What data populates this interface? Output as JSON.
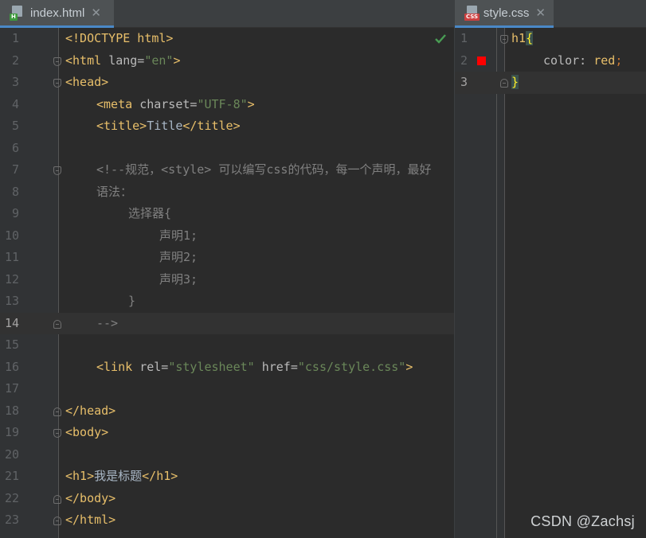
{
  "left_tab": {
    "label": "index.html",
    "badge": "H",
    "close": "✕"
  },
  "right_tab": {
    "label": "style.css",
    "badge": "CSS",
    "close": "✕"
  },
  "left_lines": [
    {
      "n": "1"
    },
    {
      "n": "2"
    },
    {
      "n": "3"
    },
    {
      "n": "4"
    },
    {
      "n": "5"
    },
    {
      "n": "6"
    },
    {
      "n": "7"
    },
    {
      "n": "8"
    },
    {
      "n": "9"
    },
    {
      "n": "10"
    },
    {
      "n": "11"
    },
    {
      "n": "12"
    },
    {
      "n": "13"
    },
    {
      "n": "14"
    },
    {
      "n": "15"
    },
    {
      "n": "16"
    },
    {
      "n": "17"
    },
    {
      "n": "18"
    },
    {
      "n": "19"
    },
    {
      "n": "20"
    },
    {
      "n": "21"
    },
    {
      "n": "22"
    },
    {
      "n": "23"
    }
  ],
  "code": {
    "l1": "<!DOCTYPE html>",
    "l2_open": "<html ",
    "l2_attr": "lang=",
    "l2_val": "\"en\"",
    "l2_close": ">",
    "l3": "<head>",
    "l4_open": "<meta ",
    "l4_attr": "charset=",
    "l4_val": "\"UTF-8\"",
    "l4_close": ">",
    "l5_open": "<title>",
    "l5_text": "Title",
    "l5_close": "</title>",
    "l7": "<!--规范，<style> 可以编写css的代码，每一个声明，最好",
    "l8": "语法：",
    "l9": "选择器{",
    "l10": "声明1;",
    "l11": "声明2;",
    "l12": "声明3;",
    "l13": "}",
    "l14": "-->",
    "l16_open": "<link ",
    "l16_attr1": "rel=",
    "l16_val1": "\"stylesheet\"",
    "l16_attr2": " href=",
    "l16_val2": "\"css/style.css\"",
    "l16_close": ">",
    "l18": "</head>",
    "l19": "<body>",
    "l21_open": "<h1>",
    "l21_text": "我是标题",
    "l21_close": "</h1>",
    "l22": "</body>",
    "l23": "</html>"
  },
  "css_lines": [
    {
      "n": "1"
    },
    {
      "n": "2"
    },
    {
      "n": "3"
    }
  ],
  "css_code": {
    "l1_sel": "h1",
    "l1_brace": "{",
    "l2_prop": "color",
    "l2_colon": ": ",
    "l2_val": "red",
    "l2_semi": ";",
    "l3_brace": "}"
  },
  "watermark": "CSDN @Zachsj",
  "colors": {
    "tab_underline": "#4a88c7",
    "tag": "#e8bf6a",
    "string": "#6a8759",
    "comment": "#808080",
    "swatch": "#ff0000"
  }
}
